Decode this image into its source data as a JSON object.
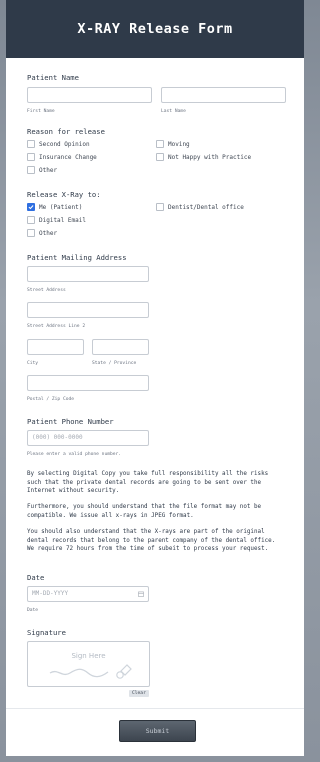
{
  "header": {
    "title": "X-RAY Release Form"
  },
  "patient_name": {
    "label": "Patient Name",
    "first_sublabel": "First Name",
    "last_sublabel": "Last Name",
    "first_value": "",
    "last_value": ""
  },
  "reason": {
    "label": "Reason for release",
    "options": [
      {
        "label": "Second Opinion",
        "checked": false
      },
      {
        "label": "Moving",
        "checked": false
      },
      {
        "label": "Insurance Change",
        "checked": false
      },
      {
        "label": "Not Happy with Practice",
        "checked": false
      },
      {
        "label": "Other",
        "checked": false
      }
    ]
  },
  "release_to": {
    "label": "Release X-Ray to:",
    "options": [
      {
        "label": "Me (Patient)",
        "checked": true
      },
      {
        "label": "Dentist/Dental office",
        "checked": false
      },
      {
        "label": "Digital Email",
        "checked": false
      },
      {
        "label": "Other",
        "checked": false
      }
    ]
  },
  "address": {
    "label": "Patient Mailing Address",
    "street_sublabel": "Street Address",
    "street2_sublabel": "Street Address Line 2",
    "city_sublabel": "City",
    "state_sublabel": "State / Province",
    "postal_sublabel": "Postal / Zip Code"
  },
  "phone": {
    "label": "Patient Phone Number",
    "placeholder": "(000) 000-0000",
    "hint": "Please enter a valid phone number."
  },
  "paragraphs": [
    "By selecting Digital Copy you take full responsibility all the risks such that the private dental records are going to be sent over the Internet without security.",
    "Furthermore, you should understand that the file format may not be compatible. We issue all x-rays in JPEG format.",
    "You should also understand that the X-rays are part of the original dental records that belong to the parent company of the dental office. We require 72 hours from the time of subeit to process your request."
  ],
  "date": {
    "label": "Date",
    "placeholder": "MM-DD-YYYY",
    "sublabel": "Date"
  },
  "signature": {
    "label": "Signature",
    "placeholder": "Sign Here",
    "clear_label": "Clear"
  },
  "submit_label": "Submit",
  "colors": {
    "header_bg": "#2f3a49",
    "checkbox_accent": "#2f6fe0",
    "submit_bg": "#4a525c"
  }
}
